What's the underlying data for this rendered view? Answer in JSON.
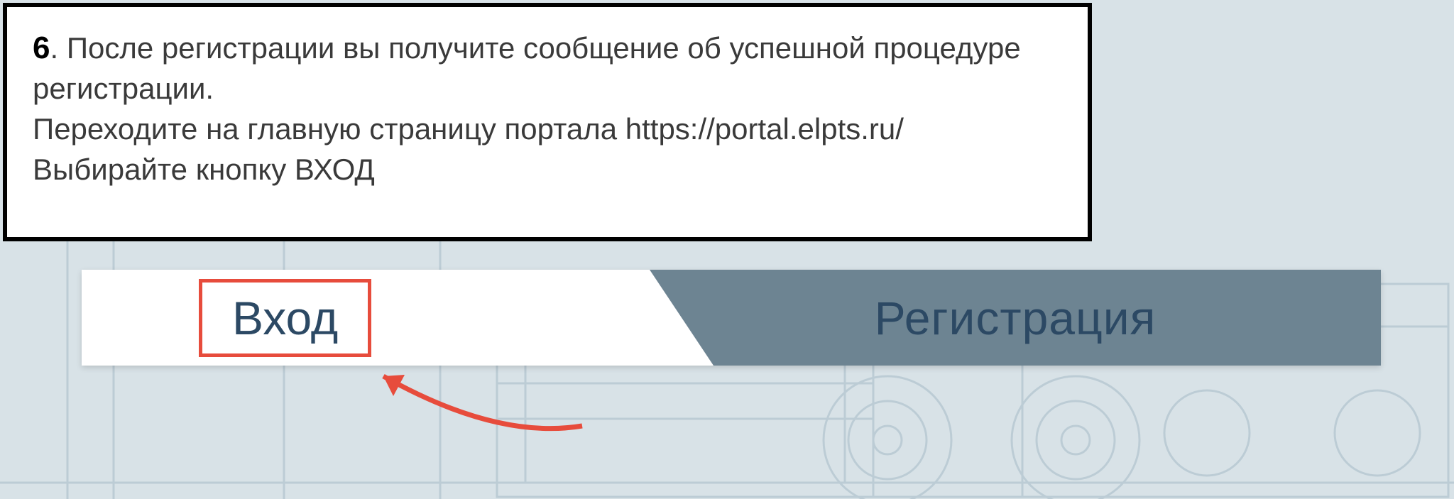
{
  "instruction": {
    "step_number": "6",
    "line1_part1": ". После регистрации вы получите сообщение об успешной процедуре",
    "line2": "регистрации.",
    "line3_part1": "Переходите на главную страницу портала  ",
    "portal_url": "https://portal.elpts.ru/",
    "line4": "Выбирайте кнопку ВХОД"
  },
  "tabs": {
    "login_label": "Вход",
    "register_label": "Регистрация"
  },
  "colors": {
    "highlight_border": "#e74c3c",
    "tab_inactive_bg": "#6d8492",
    "tab_text": "#2c4964",
    "box_border": "#000000"
  }
}
